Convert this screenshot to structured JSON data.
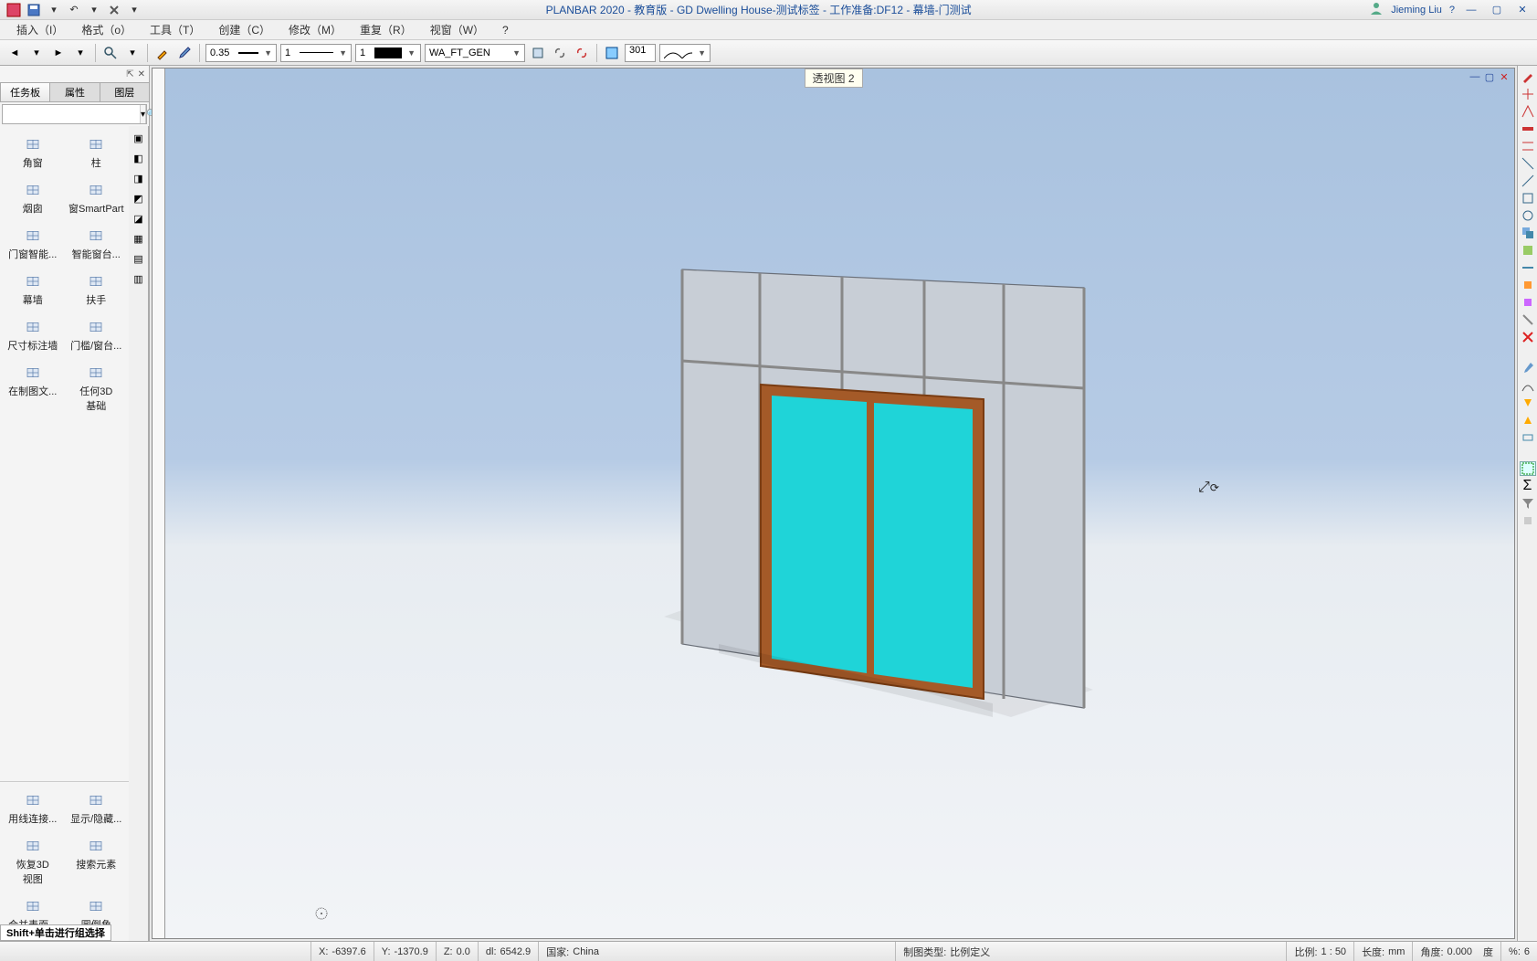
{
  "titlebar": {
    "app_title": "PLANBAR 2020 - 教育版 - GD Dwelling House-测试标签 - 工作准备:DF12 - 幕墙-门测试",
    "user": "Jieming Liu"
  },
  "menus": {
    "insert": "插入（I）",
    "format": "格式（o）",
    "tools": "工具（T）",
    "create": "创建（C）",
    "modify": "修改（M）",
    "repeat": "重复（R）",
    "view": "视窗（W）",
    "help": "?"
  },
  "toolbar": {
    "thickness": "0.35",
    "linetype": "1",
    "color_num": "1",
    "layer": "WA_FT_GEN",
    "surface_num": "301"
  },
  "left_panel": {
    "tabs": {
      "tasks": "任务板",
      "props": "属性",
      "layers": "图层"
    },
    "tools": [
      {
        "name": "corner-window-tool",
        "label": "角窗"
      },
      {
        "name": "column-tool",
        "label": "柱"
      },
      {
        "name": "chimney-tool",
        "label": "烟囱"
      },
      {
        "name": "window-smartpart-tool",
        "label": "窗SmartPart"
      },
      {
        "name": "window-door-smart-tool",
        "label": "门窗智能..."
      },
      {
        "name": "smart-sill-tool",
        "label": "智能窗台..."
      },
      {
        "name": "curtain-wall-tool",
        "label": "幕墙"
      },
      {
        "name": "handrail-tool",
        "label": "扶手"
      },
      {
        "name": "dimension-wall-tool",
        "label": "尺寸标注墙"
      },
      {
        "name": "door-window-sill-tool",
        "label": "门槛/窗台..."
      },
      {
        "name": "in-drawing-tool",
        "label": "在制图文..."
      },
      {
        "name": "any-3d-base-tool",
        "label": "任何3D\n基础"
      }
    ],
    "bottom_tools": [
      {
        "name": "wire-connect-tool",
        "label": "用线连接..."
      },
      {
        "name": "show-hide-tool",
        "label": "显示/隐藏..."
      },
      {
        "name": "restore-3d-view-tool",
        "label": "恢复3D\n视图"
      },
      {
        "name": "search-element-tool",
        "label": "搜索元素"
      },
      {
        "name": "merge-surface-tool",
        "label": "合并表面..."
      },
      {
        "name": "fillet-tool",
        "label": "圆倒角"
      }
    ]
  },
  "viewport": {
    "label": "透视图 2"
  },
  "hint": "Shift+单击进行组选择",
  "status": {
    "x_label": "X:",
    "x": "-6397.6",
    "y_label": "Y:",
    "y": "-1370.9",
    "z_label": "Z:",
    "z": "0.0",
    "dl_label": "dl:",
    "dl": "6542.9",
    "country_label": "国家:",
    "country": "China",
    "drawtype_label": "制图类型:",
    "drawtype": "比例定义",
    "scale_label": "比例:",
    "scale": "1 : 50",
    "length_label": "长度:",
    "length": "mm",
    "angle_label": "角度:",
    "angle": "0.000",
    "deg": "度",
    "pct_label": "%:",
    "pct": "6"
  }
}
